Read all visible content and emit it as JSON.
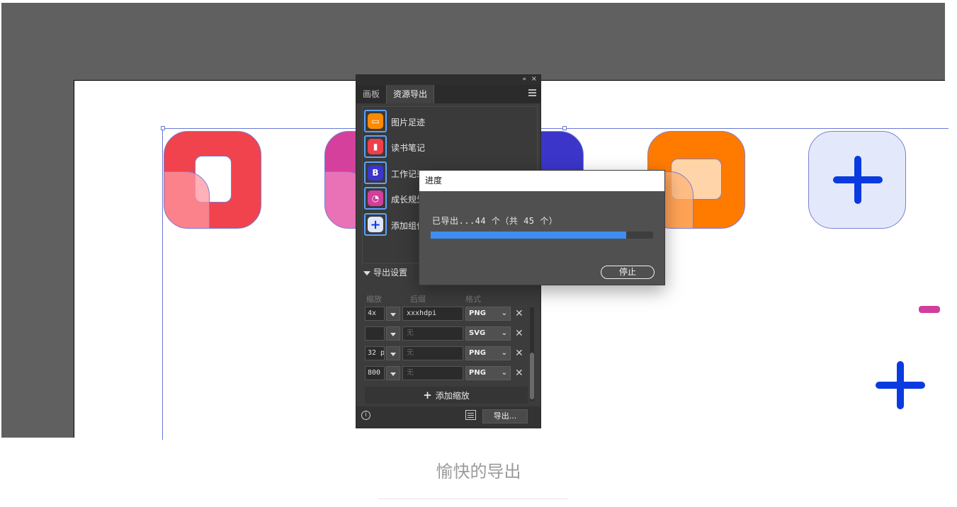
{
  "panel": {
    "tabs": [
      {
        "label": "画板",
        "active": false
      },
      {
        "label": "资源导出",
        "active": true
      }
    ],
    "assets": [
      {
        "name": "图片足迹",
        "color": "#ff8a00"
      },
      {
        "name": "读书笔记",
        "color": "#ef3f4a"
      },
      {
        "name": "工作记录",
        "color": "#3b36c9"
      },
      {
        "name": "成长规划",
        "color": "#d13f9b"
      },
      {
        "name": "添加组件",
        "color": "#dfe6f8"
      }
    ],
    "export_settings_label": "导出设置",
    "columns": [
      "缩放",
      "后缀",
      "格式"
    ],
    "rows": [
      {
        "scale": "4x",
        "suffix": "xxxhdpi",
        "format": "PNG"
      },
      {
        "scale": "",
        "suffix": "无",
        "format": "SVG"
      },
      {
        "scale": "32 p",
        "suffix": "无",
        "format": "PNG"
      },
      {
        "scale": "800",
        "suffix": "无",
        "format": "PNG"
      }
    ],
    "add_scale_label": "添加缩放",
    "export_button_label": "导出..."
  },
  "dialog": {
    "title": "进度",
    "message": "已导出...44 个（共 45 个）",
    "progress": {
      "done": 44,
      "total": 45
    },
    "stop_label": "停止"
  },
  "canvas": {
    "tile_colors": [
      "#f0434d",
      "#d4409c",
      "#3b36c9",
      "#ff7b00",
      "#e3e9fb"
    ],
    "plus_color": "#0a3be0"
  },
  "caption": "愉快的导出",
  "icons": {
    "close": "×",
    "collapse": "«",
    "remove": "✕",
    "chevron": "⌄",
    "plus": "+",
    "info": "i"
  }
}
